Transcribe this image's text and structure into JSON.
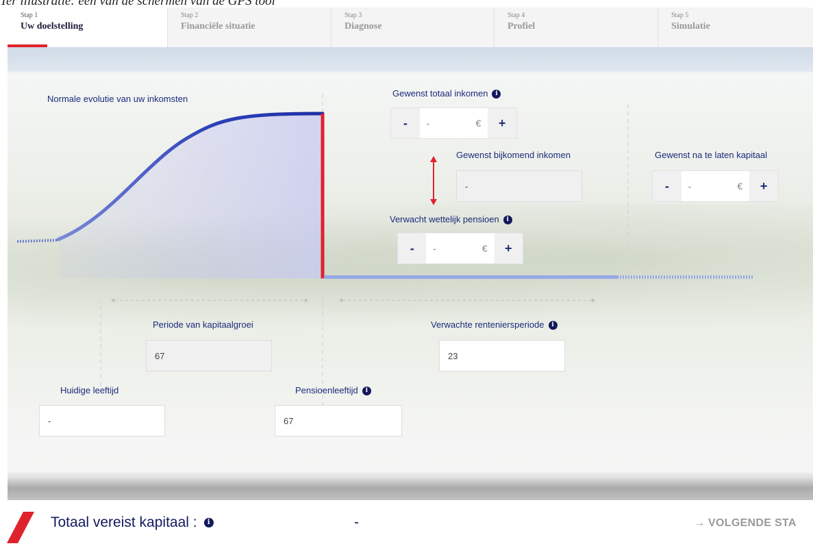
{
  "caption": "Ter illustratie: een van de schermen van de GPS tool",
  "steps": [
    {
      "num": "Stap 1",
      "name": "Uw doelstelling",
      "active": true
    },
    {
      "num": "Stap 2",
      "name": "Financiële situatie"
    },
    {
      "num": "Stap 3",
      "name": "Diagnose"
    },
    {
      "num": "Stap 4",
      "name": "Profiel"
    },
    {
      "num": "Stap 5",
      "name": "Simulatie"
    }
  ],
  "graph": {
    "income_label": "Normale evolutie van uw inkomsten"
  },
  "desired_income": {
    "label": "Gewenst totaal inkomen",
    "minus": "-",
    "value": "-",
    "currency": "€",
    "plus": "+"
  },
  "additional_income": {
    "label": "Gewenst bijkomend inkomen",
    "value": "-"
  },
  "capital_left": {
    "label": "Gewenst na te laten kapitaal",
    "minus": "-",
    "value": "-",
    "currency": "€",
    "plus": "+"
  },
  "legal_pension": {
    "label": "Verwacht wettelijk pensioen",
    "minus": "-",
    "value": "-",
    "currency": "€",
    "plus": "+"
  },
  "growth_period": {
    "label": "Periode van kapitaalgroei",
    "value": "67"
  },
  "retirement_period": {
    "label": "Verwachte renteniersperiode",
    "value": "23"
  },
  "current_age": {
    "label": "Huidige leeftijd",
    "value": "-"
  },
  "pension_age": {
    "label": "Pensioenleeftijd",
    "value": "67"
  },
  "footer": {
    "total_label": "Totaal vereist kapitaal :",
    "total_value": "-",
    "next_label": "→ VOLGENDE STA"
  },
  "icons": {
    "info": "info-icon",
    "arrow": "double-arrow-icon"
  },
  "colors": {
    "accent_red": "#e0222c",
    "navy": "#1b2a7a",
    "curve": "#2b3fb8"
  }
}
